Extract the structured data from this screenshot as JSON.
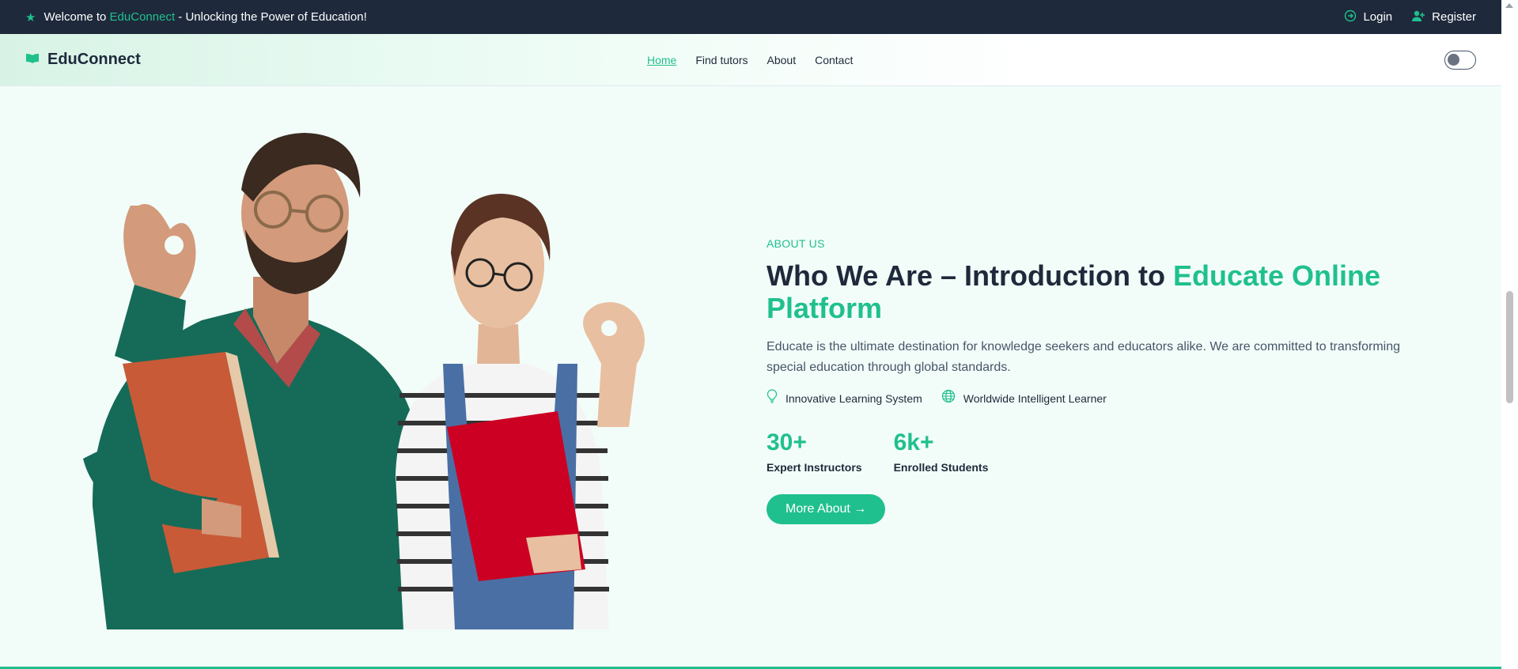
{
  "topbar": {
    "welcome_prefix": "Welcome to",
    "brand": "EduConnect",
    "welcome_suffix": "- Unlocking the Power of Education!",
    "login": "Login",
    "register": "Register"
  },
  "navbar": {
    "logo": "EduConnect",
    "links": [
      "Home",
      "Find tutors",
      "About",
      "Contact"
    ],
    "active": "Home"
  },
  "hero": {
    "eyebrow": "ABOUT US",
    "title_main": "Who We Are – Introduction to",
    "title_accent": "Educate Online Platform",
    "description": "Educate is the ultimate destination for knowledge seekers and educators alike. We are committed to transforming special education through global standards.",
    "features": [
      {
        "icon": "lightbulb-icon",
        "label": "Innovative Learning System"
      },
      {
        "icon": "globe-icon",
        "label": "Worldwide Intelligent Learner"
      }
    ],
    "stats": [
      {
        "value": "30+",
        "label": "Expert Instructors"
      },
      {
        "value": "6k+",
        "label": "Enrolled Students"
      }
    ],
    "cta": "More About →"
  },
  "colors": {
    "accent": "#20c08e",
    "dark": "#1e293b"
  }
}
